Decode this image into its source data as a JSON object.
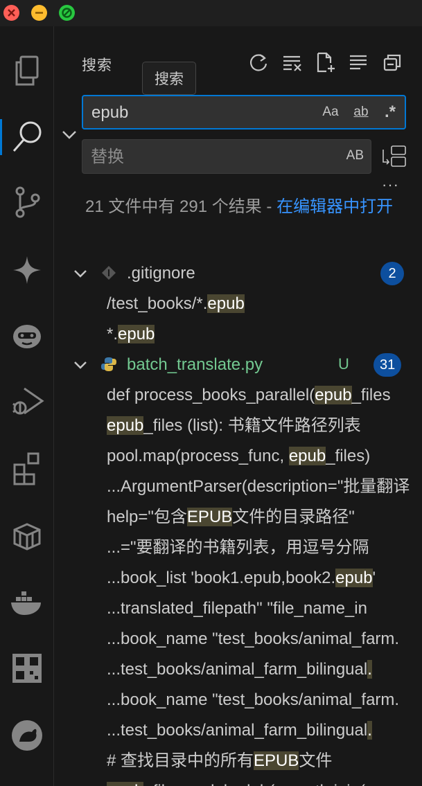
{
  "sidebar": {
    "title": "搜索",
    "tooltip": "搜索"
  },
  "search": {
    "value": "epub",
    "match_case": "Aa",
    "whole_word": "ab",
    "regex": ".*"
  },
  "replace": {
    "placeholder": "替换",
    "preserve_case": "AB"
  },
  "more_label": "···",
  "summary": {
    "text": "21 文件中有 291 个结果 - ",
    "link": "在编辑器中打开"
  },
  "files": [
    {
      "name": ".gitignore",
      "count": "2",
      "status": "",
      "matches": [
        {
          "pre": "/test_books/*.",
          "hit": "epub",
          "post": ""
        },
        {
          "pre": "*.",
          "hit": "epub",
          "post": ""
        }
      ]
    },
    {
      "name": "batch_translate.py",
      "count": "31",
      "status": "U",
      "matches": [
        {
          "pre": "def process_books_parallel(",
          "hit": "epub",
          "post": "_files"
        },
        {
          "pre": "",
          "hit": "epub",
          "post": "_files (list): 书籍文件路径列表"
        },
        {
          "pre": "pool.map(process_func, ",
          "hit": "epub",
          "post": "_files)"
        },
        {
          "pre": "...ArgumentParser(description=\"批",
          "hit": "",
          "post": "量翻译"
        },
        {
          "pre": "help=\"包含",
          "hit": "EPUB",
          "post": "文件的目录路径\""
        },
        {
          "pre": "...=\"要翻译的书籍列表，用逗号分隔",
          "hit": "",
          "post": ""
        },
        {
          "pre": "...book_list 'book1.epub,book2.",
          "hit": "epub",
          "post": "'"
        },
        {
          "pre": "...translated_filepath\" \"file_name_in",
          "hit": "",
          "post": ""
        },
        {
          "pre": "...book_name \"test_books/animal_f",
          "hit": "",
          "post": "arm."
        },
        {
          "pre": "...test_books/animal_farm_bilingual",
          "hit": ".",
          "post": ""
        },
        {
          "pre": "...book_name \"test_books/animal_f",
          "hit": "",
          "post": "arm."
        },
        {
          "pre": "...test_books/animal_farm_bilingual",
          "hit": ".",
          "post": ""
        },
        {
          "pre": "# 查找目录中的所有",
          "hit": "EPUB",
          "post": "文件"
        },
        {
          "pre": "",
          "hit": "epub",
          "post": "_files = glob.glob(os.path.join("
        }
      ]
    }
  ]
}
